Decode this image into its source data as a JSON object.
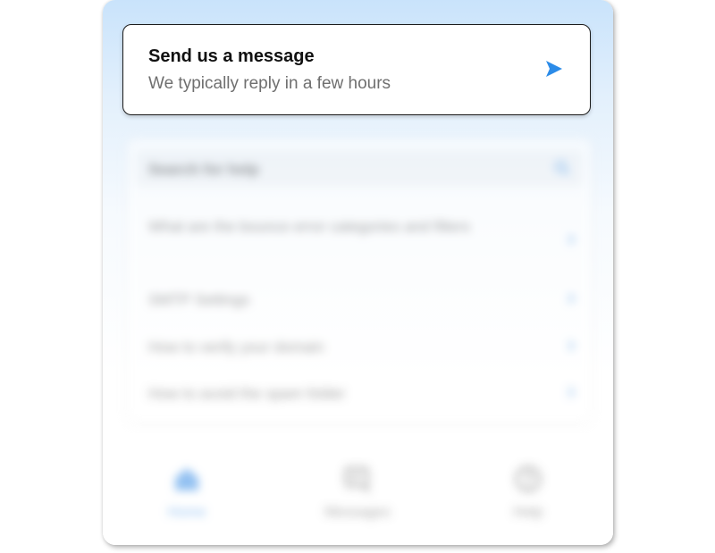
{
  "message_card": {
    "title": "Send us a message",
    "subtitle": "We typically reply in a few hours",
    "icon": "send-icon"
  },
  "help": {
    "search_placeholder": "Search for help",
    "items": [
      {
        "label": "What are the bounce error categories and filters"
      },
      {
        "label": "SMTP Settings"
      },
      {
        "label": "How to verify your domain"
      },
      {
        "label": "How to avoid the spam folder"
      }
    ]
  },
  "nav": {
    "items": [
      {
        "label": "Home",
        "icon": "home-icon",
        "active": true
      },
      {
        "label": "Messages",
        "icon": "messages-icon",
        "active": false
      },
      {
        "label": "Help",
        "icon": "help-icon",
        "active": false
      }
    ]
  },
  "colors": {
    "accent": "#2b8be8",
    "header_gradient_top": "#c9e3fb"
  }
}
